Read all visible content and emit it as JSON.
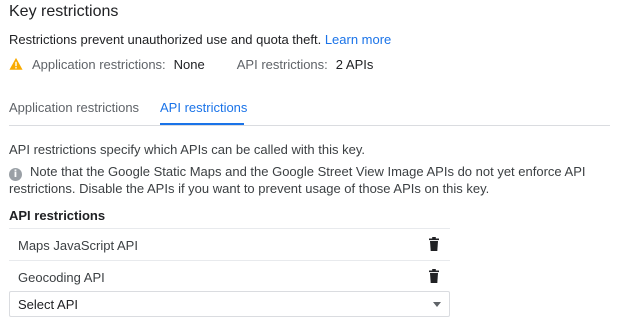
{
  "header": {
    "title": "Key restrictions"
  },
  "description": {
    "text": "Restrictions prevent unauthorized use and quota theft. ",
    "link": "Learn more"
  },
  "summary": {
    "warning_icon": "warning-icon",
    "app_label": "Application restrictions:",
    "app_value": "None",
    "api_label": "API restrictions:",
    "api_value": "2 APIs",
    "warning_color": "#f9ab00"
  },
  "tabs": [
    {
      "label": "Application restrictions",
      "active": false
    },
    {
      "label": "API restrictions",
      "active": true
    }
  ],
  "explain": "API restrictions specify which APIs can be called with this key.",
  "note": {
    "icon": "info-icon",
    "text": "Note that the Google Static Maps and the Google Street View Image APIs do not yet enforce API restrictions. Disable the APIs if you want to prevent usage of those APIs on this key."
  },
  "api_section": {
    "title": "API restrictions",
    "items": [
      {
        "label": "Maps JavaScript API",
        "icon": "trash-icon"
      },
      {
        "label": "Geocoding API",
        "icon": "trash-icon"
      }
    ],
    "select": {
      "label": "Select API",
      "icon": "dropdown-caret-icon"
    }
  },
  "colors": {
    "accent": "#1a73e8",
    "muted": "#5f6368",
    "divider": "#dadce0"
  }
}
